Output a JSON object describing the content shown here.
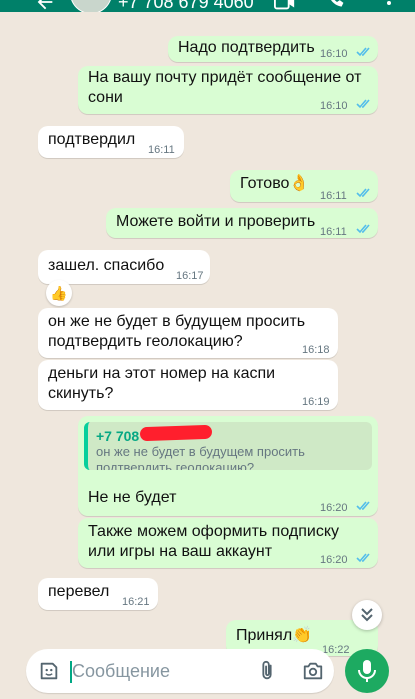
{
  "header": {
    "contact_phone": "+7 708 679 4060"
  },
  "messages": [
    {
      "dir": "out",
      "text": "Надо подтвердить",
      "time": "16:10"
    },
    {
      "dir": "out",
      "text": "На вашу почту придёт сообщение от сони",
      "line1": "На вашу почту придёт сообщение от",
      "line2": "сони",
      "time": "16:10"
    },
    {
      "dir": "in",
      "text": "подтвердил",
      "time": "16:11"
    },
    {
      "dir": "out",
      "text": "Готово👌",
      "time": "16:11"
    },
    {
      "dir": "out",
      "text": "Можете войти и проверить",
      "time": "16:11"
    },
    {
      "dir": "in",
      "text": "зашел. спасибо",
      "time": "16:17",
      "reaction": "👍"
    },
    {
      "dir": "in",
      "text": "он же не будет в будущем просить подтвердить геолокацию?",
      "line1": "он же не будет в будущем просить",
      "line2": "подтвердить геолокацию?",
      "time": "16:18"
    },
    {
      "dir": "in",
      "text": "деньги на этот номер на каспи скинуть?",
      "line1": "деньги на этот номер на каспи",
      "line2": "скинуть?",
      "time": "16:19"
    },
    {
      "dir": "out",
      "text": "Не не будет",
      "time": "16:20",
      "quote": {
        "author": "+7 708",
        "line1": "он же не будет в будущем просить",
        "line2": "подтвердить геолокацию?"
      }
    },
    {
      "dir": "out",
      "text": "Также можем оформить подписку или игры на ваш аккаунт",
      "line1": "Также можем оформить подписку",
      "line2": "или игры на ваш аккаунт",
      "time": "16:20"
    },
    {
      "dir": "in",
      "text": "перевел",
      "time": "16:21"
    },
    {
      "dir": "out",
      "text": "Принял👏",
      "time": "16:22"
    }
  ],
  "composer": {
    "placeholder": "Сообщение"
  },
  "icons": {
    "back": "arrow-left-icon",
    "video": "video-call-icon",
    "call": "phone-icon",
    "sticker": "sticker-icon",
    "attach": "paperclip-icon",
    "camera": "camera-icon",
    "mic": "microphone-icon",
    "scroll": "double-chevron-down-icon",
    "ticks": "double-check-icon"
  },
  "colors": {
    "header": "#008069",
    "outgoing": "#d9fdd3",
    "incoming": "#ffffff",
    "wallpaper": "#efe7dd",
    "ticks": "#53bdeb",
    "mic": "#1daa61"
  }
}
